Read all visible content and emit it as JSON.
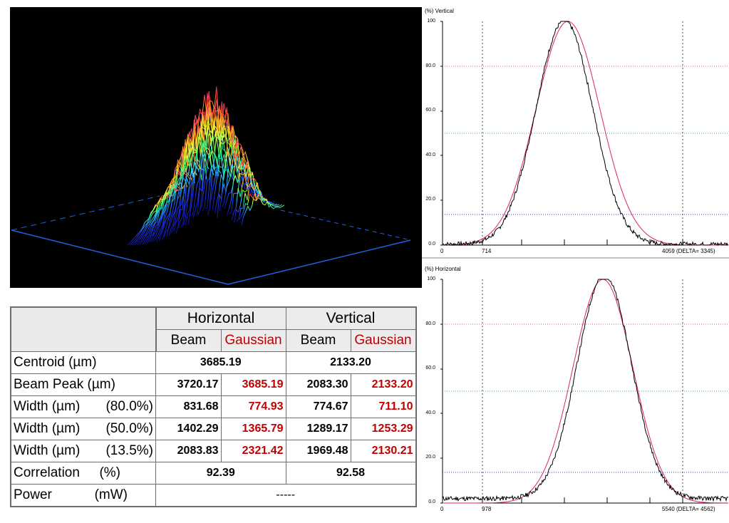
{
  "colors": {
    "red": "#cc0000",
    "beam": "#000000",
    "fit": "#e0207a",
    "grid80": "#e06060",
    "grid50": "#40b040",
    "grid135": "#4040c0"
  },
  "stats": {
    "groups": [
      "Horizontal",
      "Vertical"
    ],
    "subheads": [
      "Beam",
      "Gaussian",
      "Beam",
      "Gaussian"
    ],
    "rows": [
      {
        "label": "Centroid (µm)",
        "merged": [
          "3685.19",
          "2133.20"
        ]
      },
      {
        "label": "Beam Peak (µm)",
        "cells": [
          "3720.17",
          "3685.19",
          "2083.30",
          "2133.20"
        ]
      },
      {
        "label": "Width (µm)",
        "pct": "(80.0%)",
        "cells": [
          "831.68",
          "774.93",
          "774.67",
          "711.10"
        ]
      },
      {
        "label": "Width (µm)",
        "pct": "(50.0%)",
        "cells": [
          "1402.29",
          "1365.79",
          "1289.17",
          "1253.29"
        ]
      },
      {
        "label": "Width (µm)",
        "pct": "(13.5%)",
        "cells": [
          "2083.83",
          "2321.42",
          "1969.48",
          "2130.21"
        ]
      },
      {
        "label": "Correlation",
        "pct": "(%)",
        "merged": [
          "92.39",
          "92.58"
        ]
      },
      {
        "label": "Power",
        "pct": "(mW)",
        "span": "-----"
      }
    ]
  },
  "vertical_plot": {
    "title": "(%) Vertical",
    "y_ticks": [
      "100",
      "80.0",
      "60.0",
      "40.0",
      "20.0",
      "0.0"
    ],
    "x_left": "0",
    "x_cursor": "714",
    "x_right": "4059 (DELTA= 3345)"
  },
  "horizontal_plot": {
    "title": "(%) Horizontal",
    "y_ticks": [
      "100",
      "80.0",
      "60.0",
      "40.0",
      "20.0",
      "0.0"
    ],
    "x_left": "0",
    "x_cursor": "978",
    "x_right": "5540 (DELTA= 4562)"
  }
}
